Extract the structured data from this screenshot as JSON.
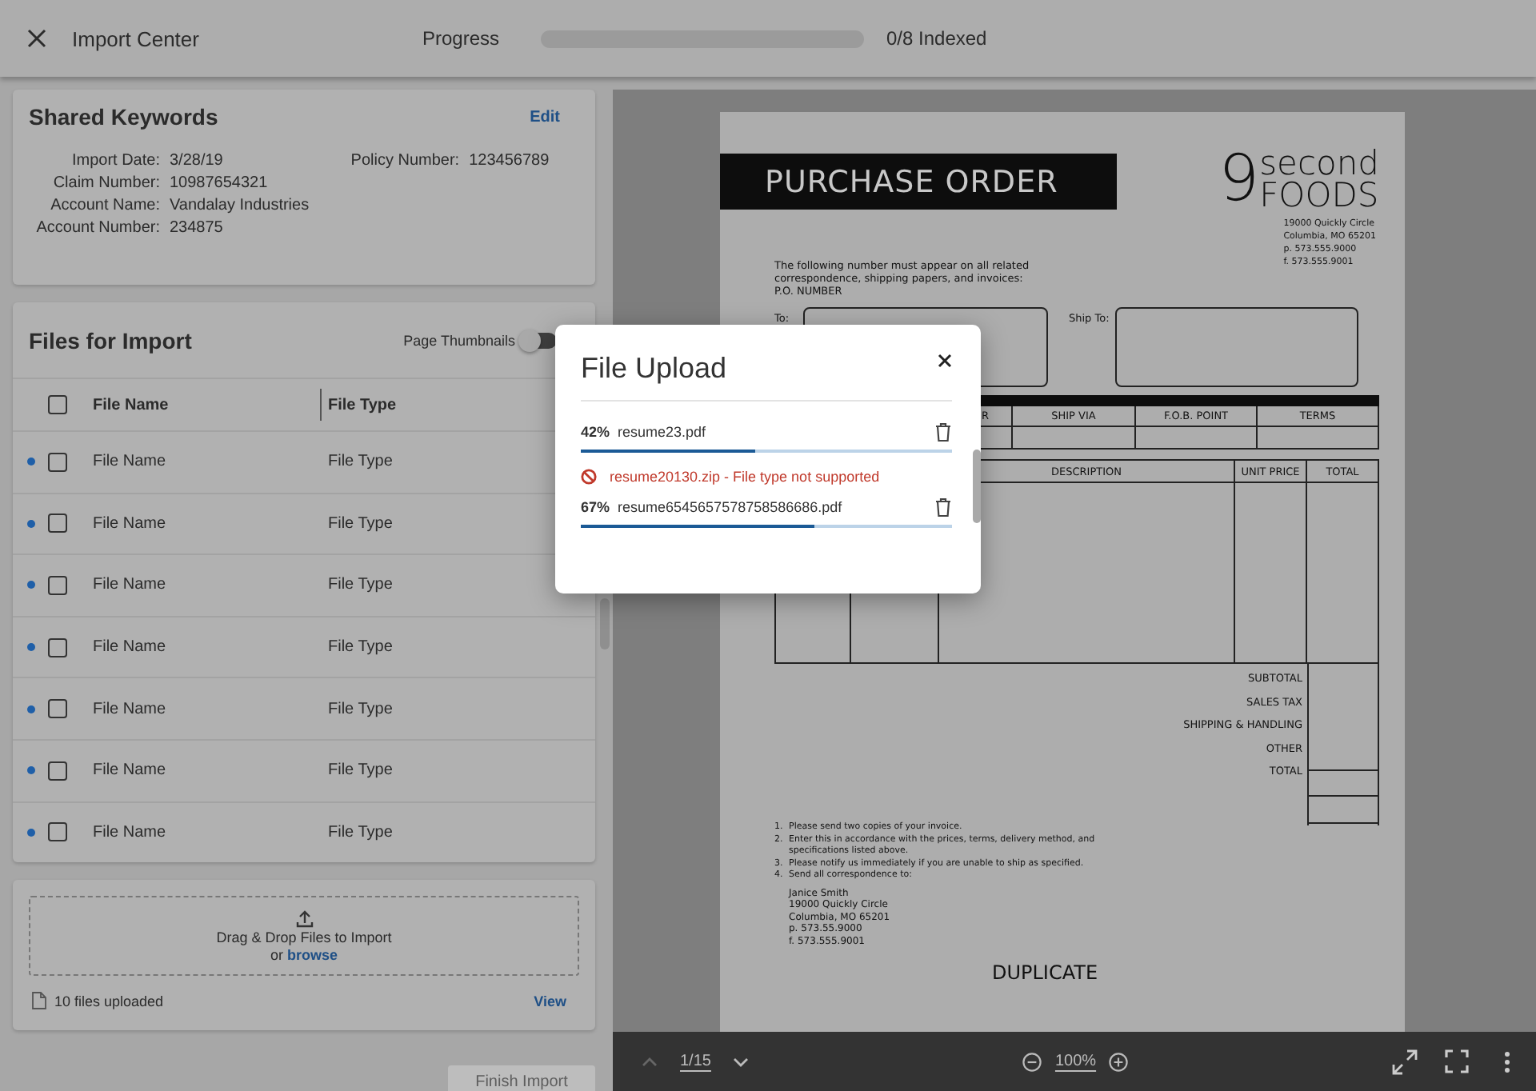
{
  "header": {
    "title": "Import Center",
    "progress": {
      "label": "Progress",
      "level": 0,
      "text": "0/8 Indexed"
    }
  },
  "keywords": {
    "title": "Shared Keywords",
    "edit": "Edit",
    "left_fields": [
      {
        "label": "Import Date:",
        "value": "3/28/19"
      },
      {
        "label": "Claim Number:",
        "value": "10987654321"
      },
      {
        "label": "Account Name:",
        "value": "Vandalay Industries"
      },
      {
        "label": "Account Number:",
        "value": "234875"
      }
    ],
    "right_fields": [
      {
        "label": "Policy Number:",
        "value": "123456789"
      }
    ]
  },
  "files": {
    "title": "Files for Import",
    "thumbnails_label": "Page Thumbnails",
    "thumbnails_on": false,
    "select_all_checked": false,
    "columns": [
      "File Name",
      "File Type"
    ],
    "rows": [
      {
        "name": "File Name",
        "type": "File Type",
        "unread": true,
        "checked": false
      },
      {
        "name": "File Name",
        "type": "File Type",
        "unread": true,
        "checked": false
      },
      {
        "name": "File Name",
        "type": "File Type",
        "unread": true,
        "checked": false
      },
      {
        "name": "File Name",
        "type": "File Type",
        "unread": true,
        "checked": false
      },
      {
        "name": "File Name",
        "type": "File Type",
        "unread": true,
        "checked": false
      },
      {
        "name": "File Name",
        "type": "File Type",
        "unread": true,
        "checked": false
      },
      {
        "name": "File Name",
        "type": "File Type",
        "unread": true,
        "checked": false
      }
    ]
  },
  "upload": {
    "drop_text": "Drag & Drop Files to Import",
    "or_text": "or",
    "browse": "browse",
    "count_text": "10 files uploaded",
    "view": "View"
  },
  "finish_button": {
    "label": "Finish Import",
    "disabled": true
  },
  "document": {
    "title": "PURCHASE ORDER",
    "logo_mark": "9",
    "logo_top": "second",
    "logo_bottom": "FOODS",
    "address": [
      "19000 Quickly Circle",
      "Columbia, MO 65201",
      "p. 573.555.9000",
      "f. 573.555.9001"
    ],
    "notice": [
      "The following number must appear on all related",
      "correspondence, shipping papers, and invoices:",
      "P.O. NUMBER"
    ],
    "to_label": "To:",
    "ship_to_label": "Ship To:",
    "table1_headers": [
      "R",
      "SHIP VIA",
      "F.O.B. POINT",
      "TERMS"
    ],
    "table2_headers": [
      "DESCRIPTION",
      "UNIT PRICE",
      "TOTAL"
    ],
    "totals": [
      "SUBTOTAL",
      "SALES TAX",
      "SHIPPING & HANDLING",
      "OTHER",
      "TOTAL"
    ],
    "notes": [
      {
        "number": "1.",
        "text": "Please send two copies of your invoice."
      },
      {
        "number": "2.",
        "text": "Enter this in accordance with the prices, terms, delivery method, and specifications listed above."
      },
      {
        "number": "3.",
        "text": "Please notify us immediately if you are unable to ship as specified."
      },
      {
        "number": "4.",
        "text": "Send all correspondence to:"
      }
    ],
    "contact": [
      "Janice Smith",
      "19000 Quickly Circle",
      "Columbia, MO 65201",
      "p. 573.55.9000",
      "f. 573.555.9001"
    ],
    "stamp": "DUPLICATE"
  },
  "viewer": {
    "page": "1/15",
    "zoom": "100%"
  },
  "modal": {
    "title": "File Upload",
    "items": [
      {
        "kind": "upload",
        "percent": "42%",
        "name": "resume23.pdf",
        "level": 0.47
      },
      {
        "kind": "error",
        "message": "resume20130.zip - File type not supported"
      },
      {
        "kind": "upload",
        "percent": "67%",
        "name": "resume6545657578758586686.pdf",
        "level": 0.63
      }
    ]
  }
}
